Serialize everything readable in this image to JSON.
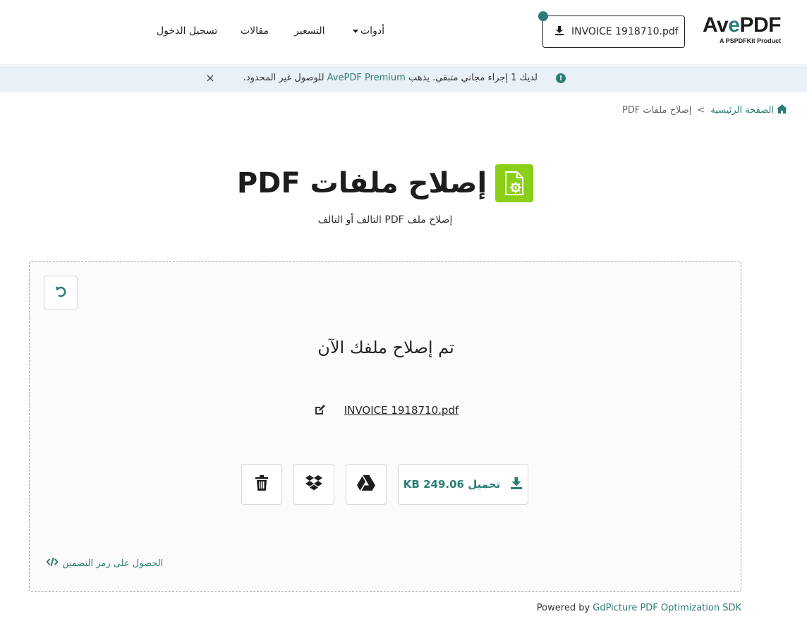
{
  "header": {
    "logo_text": "AvePDF",
    "logo_sub": "A PSPDFKit Product",
    "file_chip": "INVOICE 1918710.pdf",
    "nav": {
      "tools": "أدوات",
      "pricing": "التسعير",
      "articles": "مقالات",
      "login": "تسجيل الدخول"
    }
  },
  "notice": {
    "text_before": "لديك 1 إجراء مجاني متبقي. يذهب ",
    "link": "AvePDF Premium",
    "text_after": " للوصول غير المحدود.",
    "close": "×"
  },
  "breadcrumb": {
    "home": "الصفحة الرئيسية",
    "separator": ">",
    "current": "إصلاح ملفات PDF"
  },
  "page": {
    "title": "إصلاح ملفات PDF",
    "subtitle": "إصلاح ملف PDF التالف أو التالف"
  },
  "result": {
    "done_title": "تم إصلاح ملفك الآن",
    "file_name": "INVOICE 1918710.pdf",
    "download_label": "تحميل",
    "download_size": "249.06 KB",
    "embed_label": "الحصول على رمز التضمين"
  },
  "footer": {
    "powered_prefix": "Powered by ",
    "powered_link": "GdPicture PDF Optimization SDK"
  },
  "colors": {
    "accent": "#2b7d76",
    "tool_icon_bg": "#8ccf18",
    "notice_bg": "#eaf0f7"
  },
  "icons": [
    "download-icon",
    "info-icon",
    "close-icon",
    "home-icon",
    "repair-file-icon",
    "redo-icon",
    "edit-icon",
    "google-drive-icon",
    "dropbox-icon",
    "trash-icon",
    "code-icon",
    "caret-down-icon"
  ]
}
